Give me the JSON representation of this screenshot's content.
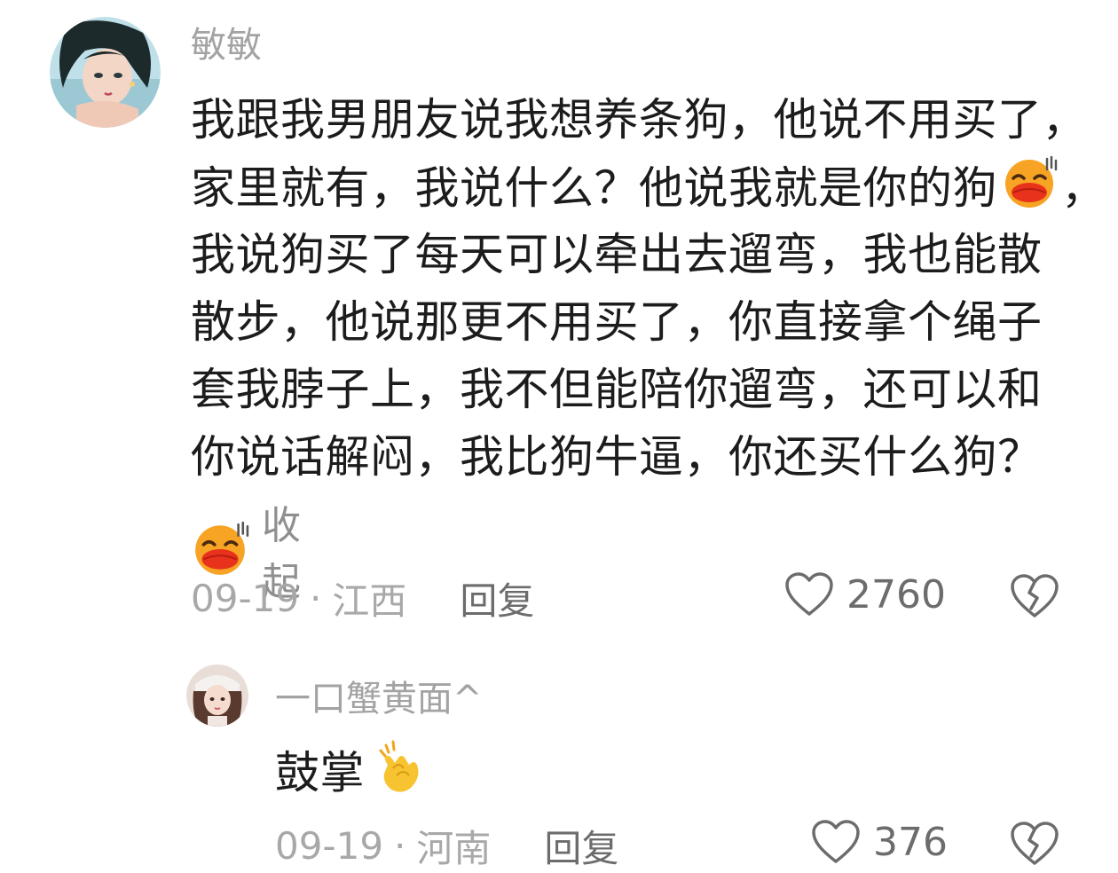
{
  "comments": [
    {
      "username": "敏敏",
      "body_lines": [
        "我跟我男朋友说我想养条狗，他说不用买了，",
        "家里就有，我说什么？他说我就是你的狗",
        "我说狗买了每天可以牵出去遛弯，我也能散",
        "散步，他说那更不用买了，你直接拿个绳子",
        "套我脖子上，我不但能陪你遛弯，还可以和",
        "你说话解闷，我比狗牛逼，你还买什么狗？"
      ],
      "line2_suffix": "，",
      "collapse_label": "收起",
      "date": "09-19",
      "separator": "·",
      "location": "江西",
      "reply_label": "回复",
      "like_count": "2760",
      "icons": [
        "avatar-anime-girl",
        "laughing-emoji",
        "heart-outline-icon",
        "broken-heart-icon"
      ]
    },
    {
      "username": "一口蟹黄面^",
      "body": "鼓掌",
      "date": "09-19",
      "separator": "·",
      "location": "河南",
      "reply_label": "回复",
      "like_count": "376",
      "icons": [
        "avatar-girl-photo",
        "clapping-hands-emoji",
        "heart-outline-icon",
        "broken-heart-icon"
      ]
    }
  ],
  "colors": {
    "text_primary": "#1c1c1c",
    "text_muted": "#a3a3a3",
    "text_action": "#6c6c6c",
    "emoji_face": "#f7a324",
    "emoji_mouth": "#e8321c",
    "clap_yellow": "#f8c331"
  }
}
